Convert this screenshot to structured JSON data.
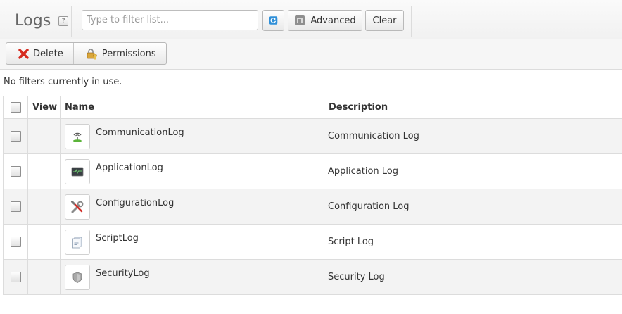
{
  "header": {
    "title": "Logs",
    "help_label": "?",
    "filter_placeholder": "Type to filter list...",
    "advanced_label": "Advanced",
    "clear_label": "Clear"
  },
  "toolbar": {
    "delete_label": "Delete",
    "permissions_label": "Permissions"
  },
  "filter_status": "No filters currently in use.",
  "table": {
    "columns": [
      "",
      "View",
      "Name",
      "Description"
    ],
    "rows": [
      {
        "name": "CommunicationLog",
        "description": "Communication Log",
        "icon": "antenna-icon"
      },
      {
        "name": "ApplicationLog",
        "description": "Application Log",
        "icon": "monitor-icon"
      },
      {
        "name": "ConfigurationLog",
        "description": "Configuration Log",
        "icon": "wrench-icon"
      },
      {
        "name": "ScriptLog",
        "description": "Script Log",
        "icon": "script-icon"
      },
      {
        "name": "SecurityLog",
        "description": "Security Log",
        "icon": "shield-icon"
      }
    ]
  },
  "colors": {
    "delete_icon": "#d62a1f",
    "refresh_icon": "#2f8fd8",
    "row_alt": "#f3f3f3",
    "border": "#dcdcdc"
  }
}
